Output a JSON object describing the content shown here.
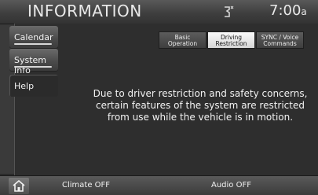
{
  "header": {
    "title": "INFORMATION",
    "clock": "7:00",
    "clock_suffix": "a"
  },
  "sidebar": {
    "items": [
      {
        "label": "Calendar"
      },
      {
        "label": "System Info"
      },
      {
        "label": "Help"
      }
    ]
  },
  "sub_tabs": [
    {
      "line1": "Basic",
      "line2": "Operation"
    },
    {
      "line1": "Driving",
      "line2": "Restriction"
    },
    {
      "line1": "SYNC / Voice",
      "line2": "Commands"
    }
  ],
  "main": {
    "message": "Due to driver restriction and safety concerns, certain features of the system are restricted from use while the vehicle is in motion."
  },
  "bottom_bar": {
    "home_icon": "home-icon",
    "climate_label": "Climate OFF",
    "audio_label": "Audio OFF"
  }
}
